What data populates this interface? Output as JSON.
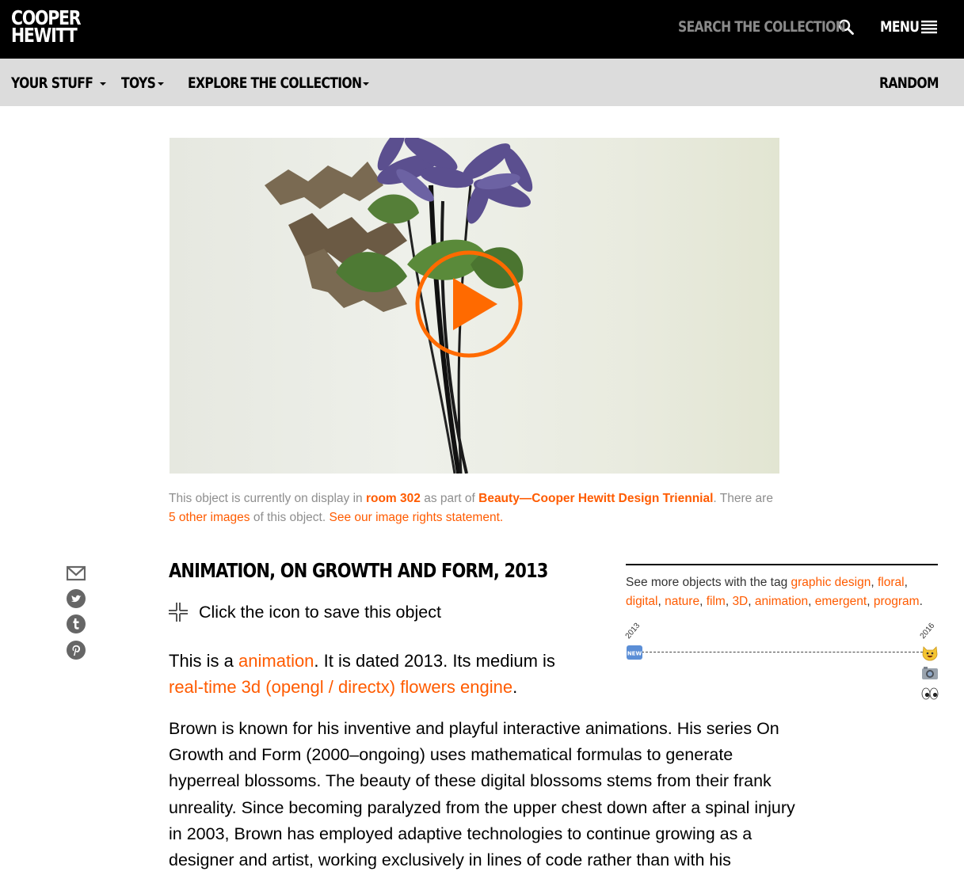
{
  "header": {
    "logo_line1": "COOPER",
    "logo_line2": "HEWITT",
    "search_label": "SEARCH THE COLLECTION",
    "menu_label": "MENU"
  },
  "nav": {
    "items": [
      {
        "label": "YOUR STUFF"
      },
      {
        "label": "TOYS"
      },
      {
        "label": "EXPLORE THE COLLECTION"
      }
    ],
    "random_label": "RANDOM"
  },
  "caption": {
    "part1": "This object is currently on display in ",
    "room_link": "room 302",
    "part2": " as part of ",
    "exhibit_link": "Beauty—Cooper Hewitt Design Triennial",
    "part3": ". There are ",
    "images_link": "5 other images",
    "part4": " of this object. ",
    "rights_link": "See our image rights statement."
  },
  "object": {
    "title": "ANIMATION, ON GROWTH AND FORM, 2013",
    "save_label": "Click the icon to save this object",
    "lead_part1": "This is a ",
    "type_link": "animation",
    "lead_part2": ". It is dated 2013. Its medium is ",
    "medium_link": "real-time 3d (opengl / directx) flowers engine",
    "lead_part3": ".",
    "description": "Brown is known for his inventive and playful interactive animations. His series On Growth and Form (2000–ongoing) uses mathematical formulas to generate hyperreal blossoms. The beauty of these digital blossoms stems from their frank unreality. Since becoming paralyzed from the upper chest down after a spinal injury in 2003, Brown has employed adaptive technologies to continue growing as a designer and artist, working exclusively in lines of code rather than with his"
  },
  "sidebar": {
    "tags_intro": "See more objects with the tag ",
    "tags": [
      "graphic design",
      "floral",
      "digital",
      "nature",
      "film",
      "3D",
      "animation",
      "emergent",
      "program"
    ],
    "timeline_start": "2013",
    "timeline_end": "2016",
    "new_badge": "NEW"
  },
  "colors": {
    "accent": "#ff5b00",
    "header_bg": "#000000",
    "nav_bg": "#dcdcdc",
    "caption_gray": "#8e8e8e",
    "search_gray": "#8a8a8a"
  },
  "icons": [
    "search-icon",
    "hamburger-icon",
    "play-icon",
    "email-icon",
    "twitter-icon",
    "tumblr-icon",
    "pinterest-icon",
    "save-plus-icon",
    "new-badge-icon",
    "smiley-cat-icon",
    "camera-icon",
    "eyes-icon"
  ]
}
